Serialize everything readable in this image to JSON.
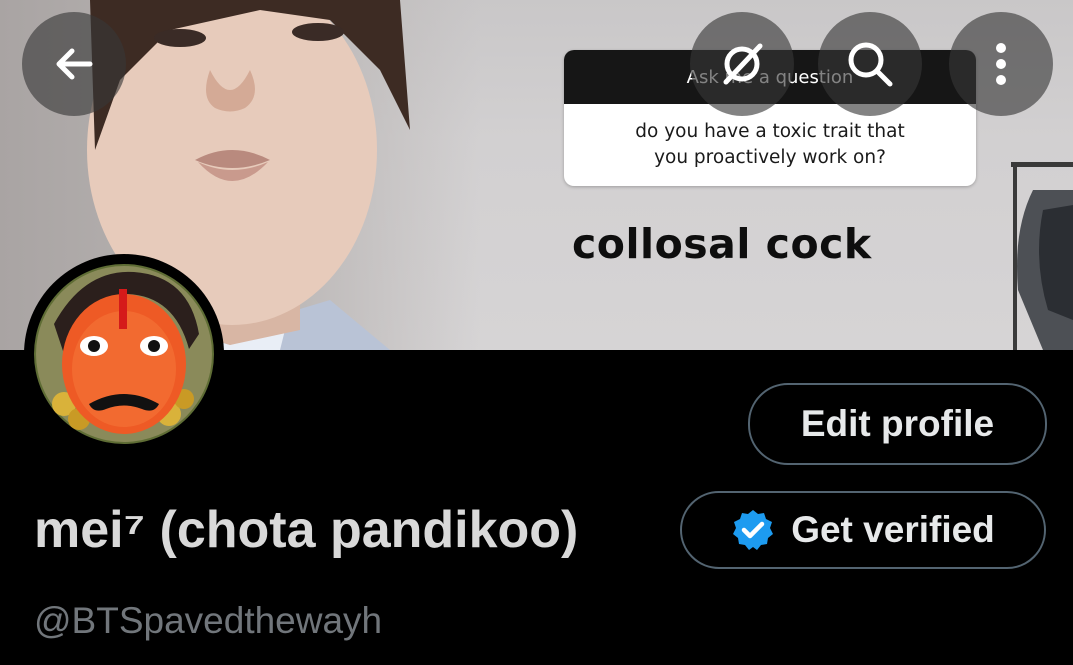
{
  "banner": {
    "ask_title": "Ask me a question",
    "question_line1": "do you have a toxic trait that",
    "question_line2": "you proactively work on?",
    "caption": "collosal cock"
  },
  "top_bar": {
    "back_icon": "arrow-left-icon",
    "grok_icon": "grok-icon",
    "search_icon": "search-icon",
    "more_icon": "more-vertical-icon"
  },
  "profile": {
    "display_name": "mei⁷ (chota pandikoo)",
    "handle": "@BTSpavedthewayh",
    "edit_profile_label": "Edit profile",
    "get_verified_label": "Get verified",
    "verified_icon": "verified-badge-icon",
    "colors": {
      "background": "#000000",
      "button_border": "#536471",
      "handle": "#71767b",
      "verified_blue": "#1d9bf0"
    }
  }
}
